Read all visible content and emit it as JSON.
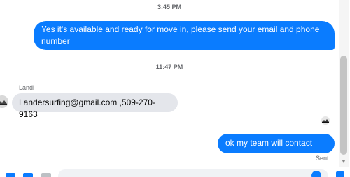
{
  "conversation": {
    "timestamps": [
      "3:45 PM",
      "11:47 PM"
    ],
    "messages": [
      {
        "direction": "outgoing",
        "text": "Yes it's available and ready for move in, please send your email and phone number"
      },
      {
        "direction": "incoming",
        "sender": "Landi",
        "text": "Landersurfing@gmail.com ,509-270-9163"
      },
      {
        "direction": "outgoing",
        "text": "ok my team will contact you"
      }
    ],
    "status": "Sent"
  },
  "composer": {
    "placeholder": "",
    "icons": [
      "plus-icon",
      "photo-icon",
      "gif-icon",
      "emoji-icon",
      "like-icon"
    ]
  },
  "colors": {
    "outgoing_bubble": "#0a7cff",
    "incoming_bubble": "#e4e6eb",
    "meta_text": "#65676b"
  }
}
